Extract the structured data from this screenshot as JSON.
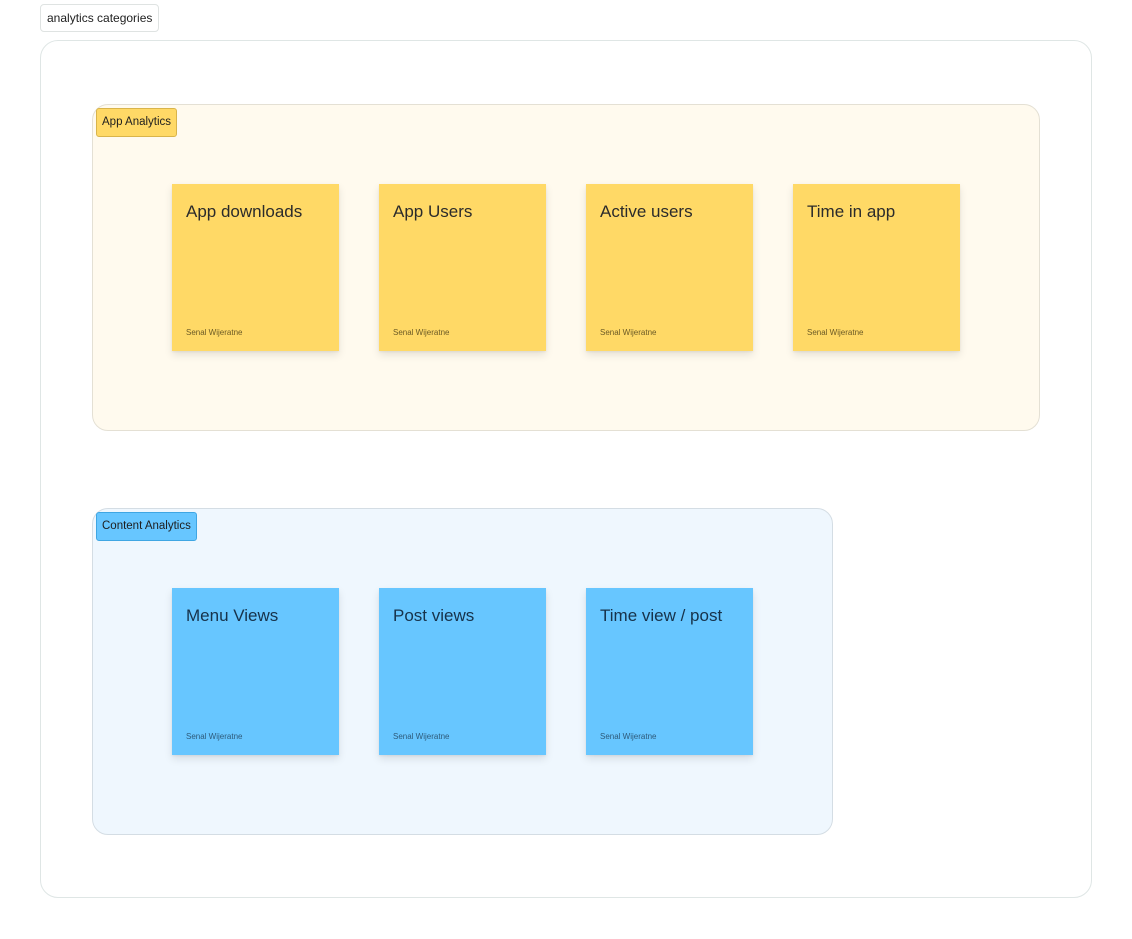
{
  "board": {
    "title": "analytics categories"
  },
  "sections": [
    {
      "label": "App Analytics",
      "color": "#ffd966",
      "stickies": [
        {
          "title": "App downloads",
          "author": "Senal Wijeratne"
        },
        {
          "title": "App Users",
          "author": "Senal Wijeratne"
        },
        {
          "title": "Active users",
          "author": "Senal Wijeratne"
        },
        {
          "title": "Time in app",
          "author": "Senal Wijeratne"
        }
      ]
    },
    {
      "label": "Content Analytics",
      "color": "#67c6ff",
      "stickies": [
        {
          "title": "Menu Views",
          "author": "Senal Wijeratne"
        },
        {
          "title": "Post views",
          "author": "Senal Wijeratne"
        },
        {
          "title": "Time view / post",
          "author": "Senal Wijeratne"
        }
      ]
    }
  ]
}
